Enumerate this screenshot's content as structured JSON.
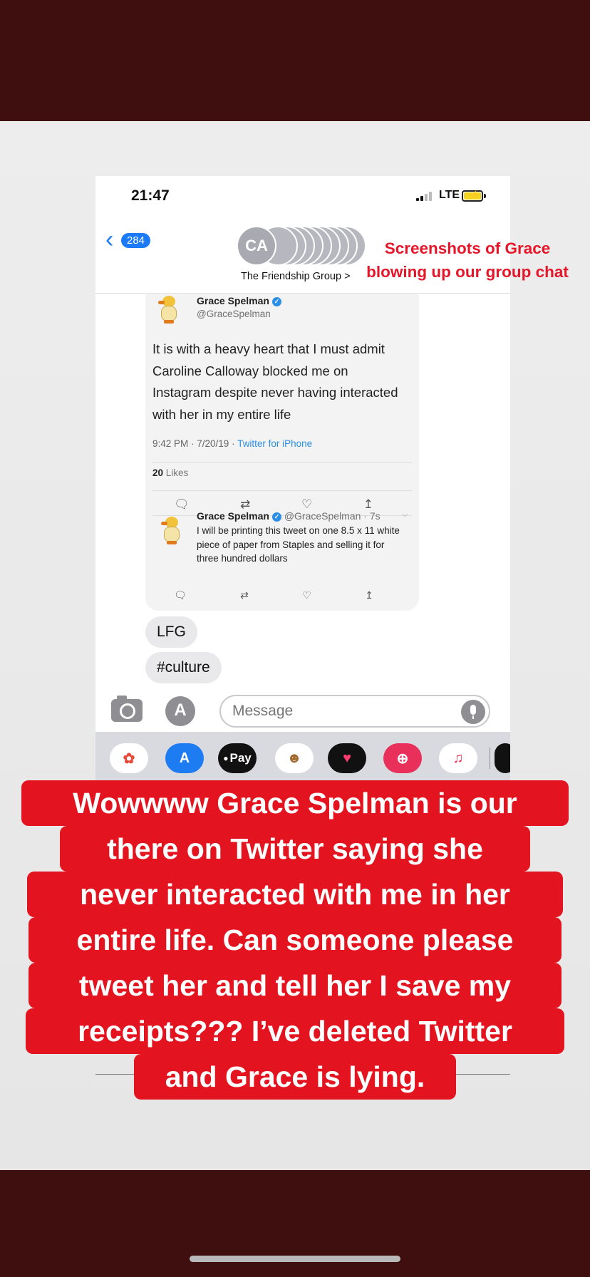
{
  "status_bar": {
    "time": "21:47",
    "network": "LTE"
  },
  "conversation": {
    "back_count": "284",
    "avatar_initials": "CA",
    "group_name": "The Friendship Group >"
  },
  "tweet_main": {
    "name": "Grace Spelman",
    "handle": "@GraceSpelman",
    "text": "It is with a heavy heart that I must admit Caroline Calloway blocked me on Instagram despite never having interacted with her in my entire life",
    "timestamp": "9:42 PM · 7/20/19 · ",
    "source": "Twitter for iPhone",
    "likes_count": "20",
    "likes_label": "Likes"
  },
  "tweet_reply": {
    "name": "Grace Spelman",
    "handle_time": "@GraceSpelman · 7s",
    "text": "I will be printing this tweet on one 8.5 x 11 white piece of paper from Staples and selling it for three hundred dollars"
  },
  "messages": [
    "LFG",
    "#culture"
  ],
  "composer": {
    "placeholder": "Message"
  },
  "app_drawer": {
    "apple_pay_label": "Pay",
    "icons": [
      "photos-icon",
      "app-store-icon",
      "apple-pay-icon",
      "animoji-icon",
      "digital-touch-icon",
      "image-search-icon",
      "music-icon"
    ]
  },
  "annotation": {
    "line1": "Screenshots of Grace",
    "line2": "blowing up our group chat"
  },
  "caption": {
    "lines": [
      "Wowwww Grace Spelman is our",
      "there on Twitter saying she",
      "never interacted with me in her",
      "entire life. Can someone please",
      "tweet her and tell her I save my",
      "receipts??? I’ve deleted Twitter",
      "and Grace is lying."
    ]
  },
  "colors": {
    "story_band": "#3f0f0f",
    "caption_bg": "#e3141f",
    "annotation_text": "#e6162a",
    "imessage_blue": "#1a7af8",
    "twitter_blue": "#2b8fe6"
  }
}
